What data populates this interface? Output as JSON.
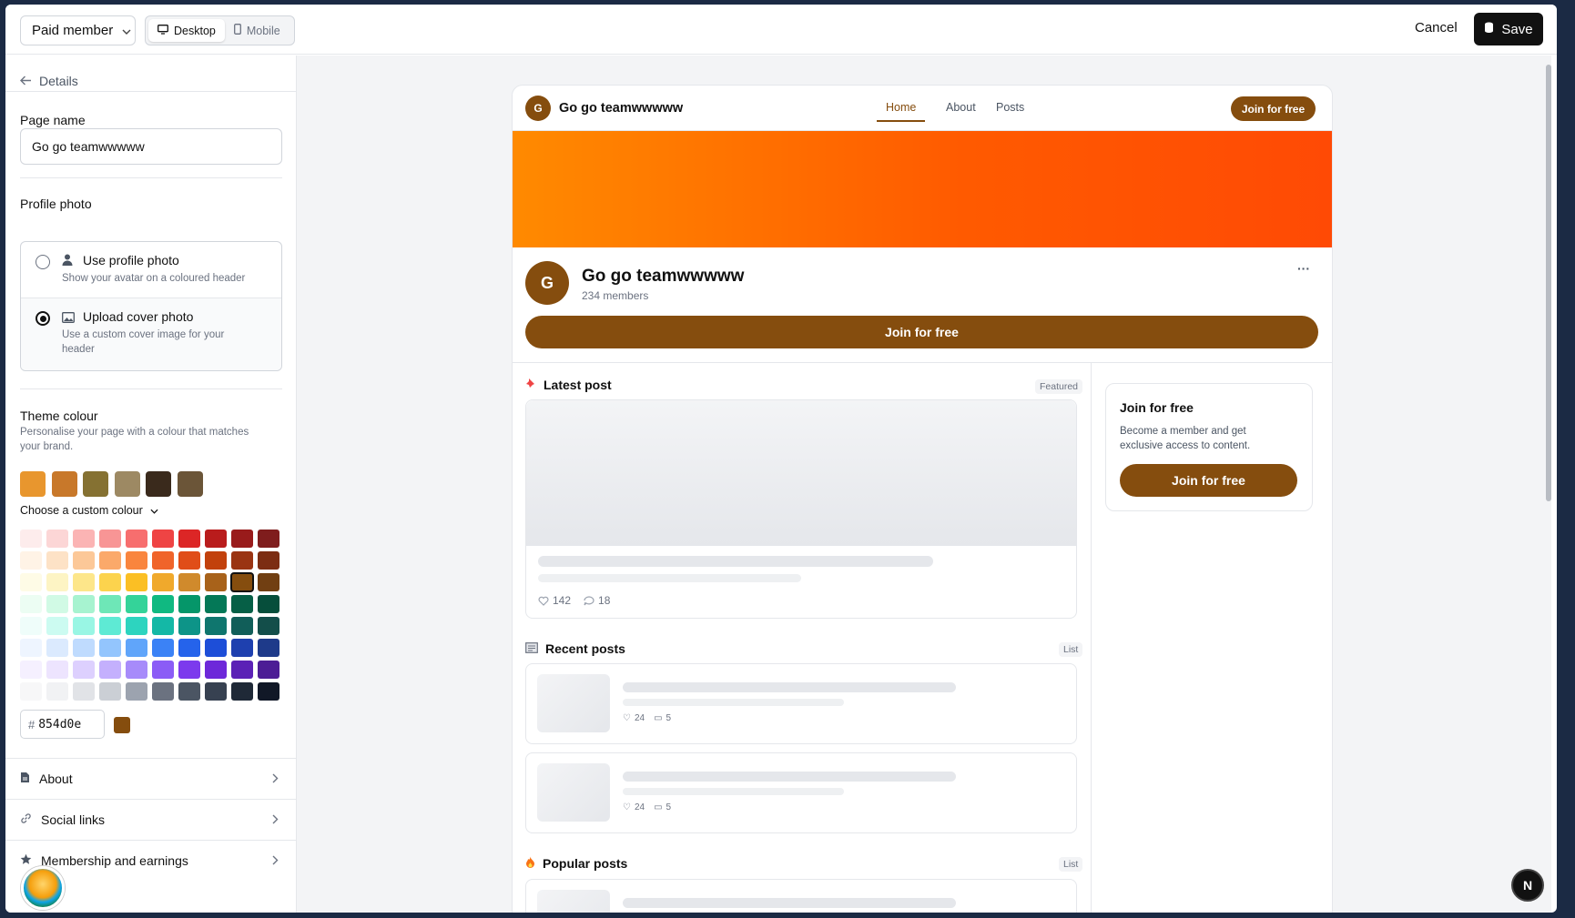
{
  "topbar": {
    "member_select": "Paid member",
    "desktop": "Desktop",
    "mobile": "Mobile",
    "cancel": "Cancel",
    "save": "Save"
  },
  "sidebar": {
    "back": "Details",
    "page_name_label": "Page name",
    "page_name_value": "Go go teamwwwww",
    "profile_photo_label": "Profile photo",
    "opt1_title": "Use profile photo",
    "opt1_desc": "Show your avatar on a coloured header",
    "opt2_title": "Upload cover photo",
    "opt2_desc": "Use a custom cover image for your header",
    "theme_label": "Theme colour",
    "theme_desc": "Personalise your page with a colour that matches your brand.",
    "presets": [
      "#e8962e",
      "#c8782a",
      "#857132",
      "#9d8963",
      "#3a2a1c",
      "#6b5538"
    ],
    "custom_toggle": "Choose a custom colour",
    "palette": [
      [
        "#fdecec",
        "#fcd6d6",
        "#fbb4b4",
        "#f89595",
        "#f76e6e",
        "#ef4444",
        "#dc2626",
        "#b91c1c",
        "#991b1b",
        "#7f1d1d"
      ],
      [
        "#fff3e6",
        "#fde2c6",
        "#fcc898",
        "#fba96a",
        "#f9853e",
        "#f0642a",
        "#e04d18",
        "#c2410c",
        "#9a3412",
        "#7c2d12"
      ],
      [
        "#fefbe6",
        "#fdf4c4",
        "#fde68a",
        "#fcd34d",
        "#fbbf24",
        "#f0a92c",
        "#d08a2c",
        "#a8621a",
        "#854d0e",
        "#713f12"
      ],
      [
        "#ecfdf3",
        "#d1fae5",
        "#a7f3d0",
        "#6ee7b7",
        "#34d399",
        "#10b981",
        "#059669",
        "#047857",
        "#065f46",
        "#064e3b"
      ],
      [
        "#effdfa",
        "#ccfbf1",
        "#99f6e4",
        "#5eead4",
        "#2dd4bf",
        "#14b8a6",
        "#0d9488",
        "#0f766e",
        "#115e59",
        "#134e4a"
      ],
      [
        "#eef5ff",
        "#dbeafe",
        "#bfdbfe",
        "#93c5fd",
        "#60a5fa",
        "#3b82f6",
        "#2563eb",
        "#1d4ed8",
        "#1e40af",
        "#1e3a8a"
      ],
      [
        "#f5f0ff",
        "#ede4fe",
        "#ddd0fe",
        "#c4b0fd",
        "#a78bfa",
        "#8b5cf6",
        "#7c3aed",
        "#6d28d9",
        "#5b21b6",
        "#4c1d95"
      ],
      [
        "#f7f7f8",
        "#f1f2f4",
        "#e1e3e7",
        "#cbcfd5",
        "#9ca3af",
        "#6b7280",
        "#4b5563",
        "#374151",
        "#1f2937",
        "#111827"
      ]
    ],
    "selected_colour": "#854d0e",
    "hex_prefix": "#",
    "hex_value": "854d0e",
    "rows": [
      "About",
      "Social links",
      "Membership and earnings"
    ]
  },
  "preview": {
    "initial": "G",
    "site_name": "Go go teamwwwww",
    "nav": [
      "Home",
      "About",
      "Posts"
    ],
    "join_nav": "Join for free",
    "members": "234 members",
    "join_big": "Join for free",
    "latest_title": "Latest post",
    "featured_badge": "Featured",
    "latest_likes": "142",
    "latest_comments": "18",
    "recent_title": "Recent posts",
    "list_badge": "List",
    "recent_likes": "24",
    "recent_comments": "5",
    "popular_title": "Popular posts",
    "side_title": "Join for free",
    "side_desc": "Become a member and get exclusive access to content.",
    "side_btn": "Join for free",
    "more": "···"
  },
  "theme": {
    "accent": "#854d0e",
    "dark": "#111111"
  },
  "launcher": "N"
}
